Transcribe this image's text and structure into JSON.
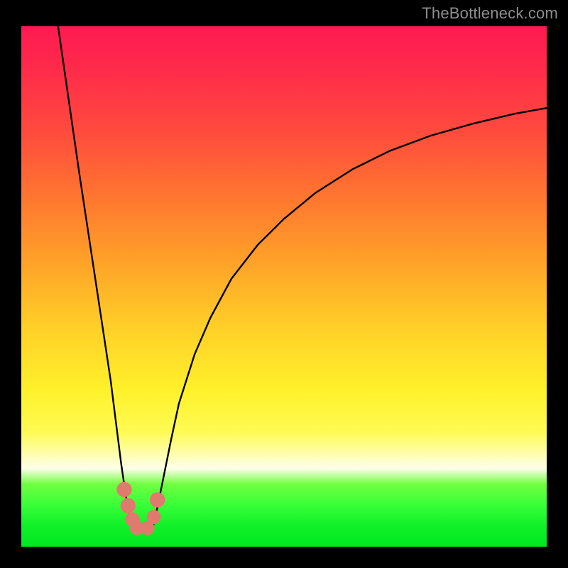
{
  "watermark": {
    "text": "TheBottleneck.com"
  },
  "chart_data": {
    "type": "line",
    "title": "",
    "xlabel": "",
    "ylabel": "",
    "xlim": [
      0,
      100
    ],
    "ylim": [
      0,
      100
    ],
    "grid": false,
    "background": "vertical-gradient red→orange→yellow→pale→green",
    "series": [
      {
        "name": "left-branch",
        "x": [
          7.0,
          8.0,
          9.0,
          10.0,
          11.0,
          12.5,
          14.0,
          15.5,
          17.0,
          18.0,
          19.0,
          19.8,
          20.5,
          21.0
        ],
        "y": [
          100,
          93,
          86,
          79,
          72,
          62,
          52,
          42,
          32,
          24,
          16,
          10.5,
          6.0,
          3.5
        ]
      },
      {
        "name": "right-branch",
        "x": [
          25.0,
          26.0,
          27.0,
          28.5,
          30.0,
          33.0,
          36.0,
          40.0,
          45.0,
          50.0,
          56.0,
          63.0,
          70.0,
          78.0,
          86.0,
          94.0,
          100.0
        ],
        "y": [
          3.5,
          8.0,
          13.0,
          20.5,
          27.5,
          37.0,
          44.0,
          51.5,
          58.0,
          63.0,
          68.0,
          72.5,
          76.0,
          79.0,
          81.3,
          83.2,
          84.3
        ]
      },
      {
        "name": "valley-floor",
        "x": [
          21.0,
          22.3,
          23.5,
          25.0
        ],
        "y": [
          3.5,
          3.1,
          3.1,
          3.5
        ]
      }
    ],
    "markers": [
      {
        "name": "marker-left-upper",
        "x": 19.6,
        "y": 11.0,
        "size": 2.9,
        "color": "#e07a6e"
      },
      {
        "name": "marker-left-mid",
        "x": 20.3,
        "y": 7.9,
        "size": 2.9,
        "color": "#e07a6e"
      },
      {
        "name": "marker-left-low",
        "x": 21.1,
        "y": 5.3,
        "size": 2.7,
        "color": "#e07a6e"
      },
      {
        "name": "marker-bottom-a",
        "x": 22.0,
        "y": 3.6,
        "size": 2.7,
        "color": "#e07a6e"
      },
      {
        "name": "marker-bottom-b",
        "x": 24.0,
        "y": 3.6,
        "size": 2.7,
        "color": "#e07a6e"
      },
      {
        "name": "marker-right-low",
        "x": 25.2,
        "y": 5.7,
        "size": 2.7,
        "color": "#e07a6e"
      },
      {
        "name": "marker-right-upper",
        "x": 25.9,
        "y": 9.0,
        "size": 2.9,
        "color": "#e07a6e"
      }
    ]
  }
}
